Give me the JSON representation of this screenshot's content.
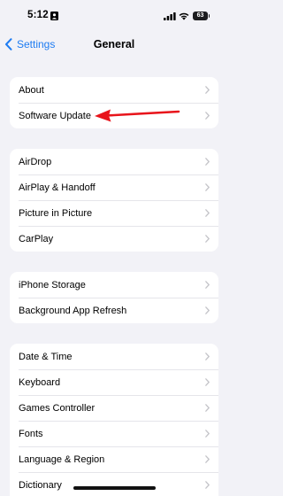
{
  "status_bar": {
    "time": "5:12",
    "battery_level": "63",
    "icons": [
      "person-badge-icon",
      "signal-icon",
      "wifi-icon",
      "battery-icon"
    ]
  },
  "nav": {
    "back_label": "Settings",
    "title": "General"
  },
  "groups": [
    {
      "rows": [
        {
          "label": "About"
        },
        {
          "label": "Software Update"
        }
      ]
    },
    {
      "rows": [
        {
          "label": "AirDrop"
        },
        {
          "label": "AirPlay & Handoff"
        },
        {
          "label": "Picture in Picture"
        },
        {
          "label": "CarPlay"
        }
      ]
    },
    {
      "rows": [
        {
          "label": "iPhone Storage"
        },
        {
          "label": "Background App Refresh"
        }
      ]
    },
    {
      "rows": [
        {
          "label": "Date & Time"
        },
        {
          "label": "Keyboard"
        },
        {
          "label": "Games Controller"
        },
        {
          "label": "Fonts"
        },
        {
          "label": "Language & Region"
        },
        {
          "label": "Dictionary"
        }
      ]
    }
  ],
  "colors": {
    "accent": "#1e7cf2",
    "background": "#f2f2f7",
    "annotation_arrow": "#e8141b"
  }
}
